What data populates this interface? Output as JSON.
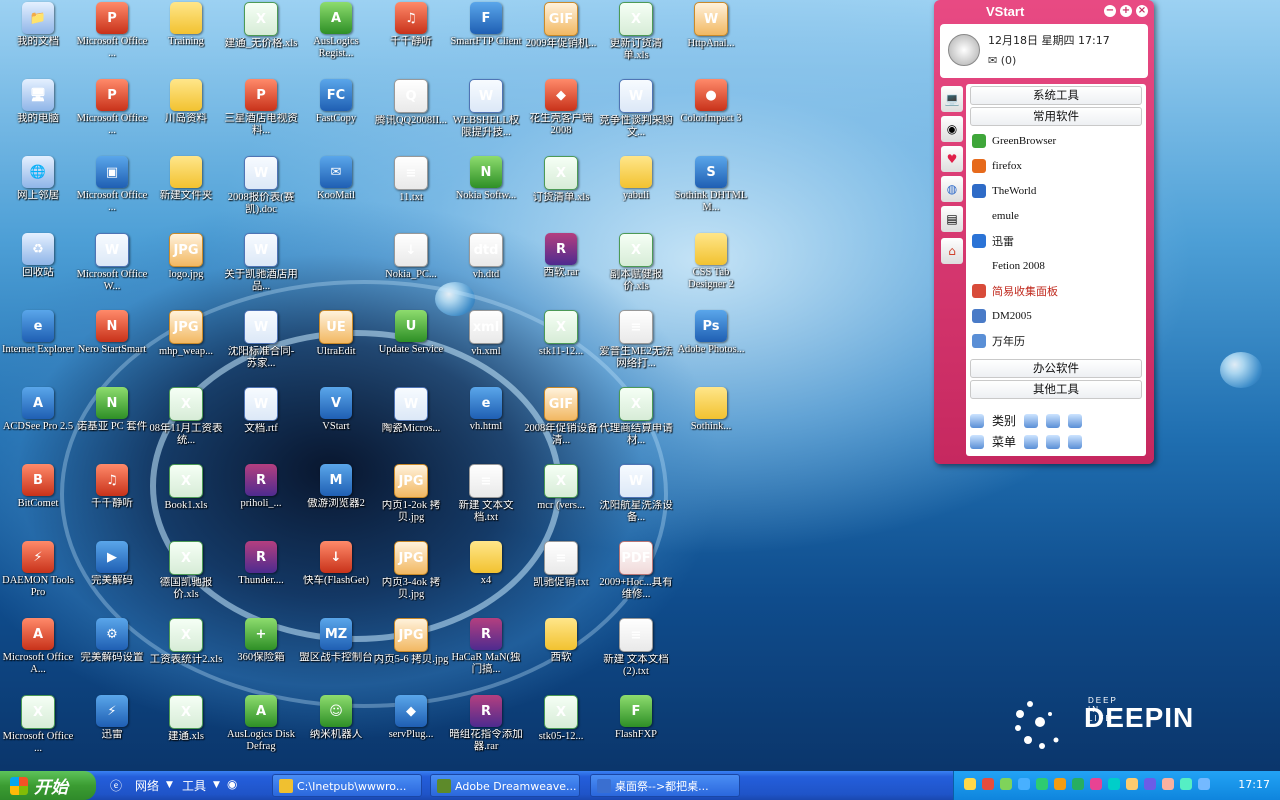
{
  "desktop": {
    "icons": [
      {
        "label": "我的文档",
        "type": "sys",
        "glyph": "📁"
      },
      {
        "label": "Microsoft Office ...",
        "type": "red",
        "glyph": "P"
      },
      {
        "label": "Training",
        "type": "folder",
        "glyph": ""
      },
      {
        "label": "建通_无价格.xls",
        "type": "xls",
        "glyph": "X"
      },
      {
        "label": "AusLogics Regist...",
        "type": "green",
        "glyph": "A"
      },
      {
        "label": "千千静听",
        "type": "red",
        "glyph": "♫"
      },
      {
        "label": "SmartFTP Client",
        "type": "app",
        "glyph": "F"
      },
      {
        "label": "2009年促销机...",
        "type": "jpg",
        "glyph": "GIF"
      },
      {
        "label": "更新订货清单.xls",
        "type": "xls",
        "glyph": "X"
      },
      {
        "label": "HttpAnal...",
        "type": "jpg",
        "glyph": "W"
      },
      {
        "label": "我的电脑",
        "type": "sys",
        "glyph": "🖥"
      },
      {
        "label": "Microsoft Office ...",
        "type": "red",
        "glyph": "P"
      },
      {
        "label": "川岛资料",
        "type": "folder",
        "glyph": ""
      },
      {
        "label": "三星酒店电视资料...",
        "type": "red",
        "glyph": "P"
      },
      {
        "label": "FastCopy",
        "type": "app",
        "glyph": "FC"
      },
      {
        "label": "腾讯QQ2008II...",
        "type": "txt",
        "glyph": "Q"
      },
      {
        "label": "WEBSHELL权限提升技...",
        "type": "doc",
        "glyph": "W"
      },
      {
        "label": "花生壳客户端 2008",
        "type": "red",
        "glyph": "◆"
      },
      {
        "label": "竞争性谈判采购文...",
        "type": "doc",
        "glyph": "W"
      },
      {
        "label": "ColorImpact 3",
        "type": "red",
        "glyph": "●"
      },
      {
        "label": "网上邻居",
        "type": "sys",
        "glyph": "🌐"
      },
      {
        "label": "Microsoft Office ...",
        "type": "app",
        "glyph": "▣"
      },
      {
        "label": "新建文件夹",
        "type": "folder",
        "glyph": ""
      },
      {
        "label": "2008报价表(赛凯).doc",
        "type": "doc",
        "glyph": "W"
      },
      {
        "label": "KooMail",
        "type": "app",
        "glyph": "✉"
      },
      {
        "label": "11.txt",
        "type": "txt",
        "glyph": "≡"
      },
      {
        "label": "Nokia Softw...",
        "type": "green",
        "glyph": "N"
      },
      {
        "label": "订货清单.xls",
        "type": "xls",
        "glyph": "X"
      },
      {
        "label": "yabuli",
        "type": "folder",
        "glyph": ""
      },
      {
        "label": "Sothink DHTML M...",
        "type": "app",
        "glyph": "S"
      },
      {
        "label": "回收站",
        "type": "sys",
        "glyph": "♻"
      },
      {
        "label": "Microsoft Office W...",
        "type": "doc",
        "glyph": "W"
      },
      {
        "label": "logo.jpg",
        "type": "jpg",
        "glyph": "JPG"
      },
      {
        "label": "关于凯驰酒店用品...",
        "type": "doc",
        "glyph": "W"
      },
      {
        "label": "Nokia_PC...",
        "type": "txt",
        "glyph": "↓"
      },
      {
        "label": "vh.dtd",
        "type": "txt",
        "glyph": "dtd"
      },
      {
        "label": "西软.rar",
        "type": "rar",
        "glyph": "R"
      },
      {
        "label": "副本赋健报价.xls",
        "type": "xls",
        "glyph": "X"
      },
      {
        "label": "CSS Tab Designer 2",
        "type": "folder",
        "glyph": ""
      },
      {
        "label": "Internet Explorer",
        "type": "app",
        "glyph": "e"
      },
      {
        "label": "Nero StartSmart",
        "type": "red",
        "glyph": "N"
      },
      {
        "label": "mhp_weap...",
        "type": "jpg",
        "glyph": "JPG"
      },
      {
        "label": "沈阳标准合同-苏家...",
        "type": "doc",
        "glyph": "W"
      },
      {
        "label": "UltraEdit",
        "type": "jpg",
        "glyph": "UE"
      },
      {
        "label": "Update Service",
        "type": "green",
        "glyph": "U"
      },
      {
        "label": "vh.xml",
        "type": "txt",
        "glyph": "xml"
      },
      {
        "label": "stk11-12...",
        "type": "xls",
        "glyph": "X"
      },
      {
        "label": "爱普生ME2无法网络打...",
        "type": "txt",
        "glyph": "≡"
      },
      {
        "label": "Adobe Photos...",
        "type": "app",
        "glyph": "Ps"
      },
      {
        "label": "ACDSee Pro 2.5",
        "type": "app",
        "glyph": "A"
      },
      {
        "label": "诺基亚 PC 套件",
        "type": "green",
        "glyph": "N"
      },
      {
        "label": "08年11月工资表统...",
        "type": "xls",
        "glyph": "X"
      },
      {
        "label": "文档.rtf",
        "type": "doc",
        "glyph": "W"
      },
      {
        "label": "VStart",
        "type": "app",
        "glyph": "V"
      },
      {
        "label": "陶瓷Micros...",
        "type": "doc",
        "glyph": "W"
      },
      {
        "label": "vh.html",
        "type": "app",
        "glyph": "e"
      },
      {
        "label": "2008年促销设备清...",
        "type": "jpg",
        "glyph": "GIF"
      },
      {
        "label": "代理商结算申请材...",
        "type": "xls",
        "glyph": "X"
      },
      {
        "label": "Sothink...",
        "type": "folder",
        "glyph": ""
      },
      {
        "label": "BitComet",
        "type": "red",
        "glyph": "B"
      },
      {
        "label": "千千静听",
        "type": "red",
        "glyph": "♫"
      },
      {
        "label": "Book1.xls",
        "type": "xls",
        "glyph": "X"
      },
      {
        "label": "priholi_...",
        "type": "rar",
        "glyph": "R"
      },
      {
        "label": "傲游浏览器2",
        "type": "app",
        "glyph": "M"
      },
      {
        "label": "内页1-2ok 拷贝.jpg",
        "type": "jpg",
        "glyph": "JPG"
      },
      {
        "label": "新建 文本文档.txt",
        "type": "txt",
        "glyph": "≡"
      },
      {
        "label": "mcr (vers...",
        "type": "xls",
        "glyph": "X"
      },
      {
        "label": "沈阳航星洗涤设备...",
        "type": "doc",
        "glyph": "W"
      },
      {
        "label": "DAEMON Tools Pro",
        "type": "red",
        "glyph": "⚡"
      },
      {
        "label": "完美解码",
        "type": "app",
        "glyph": "▶"
      },
      {
        "label": "德国凯驰报价.xls",
        "type": "xls",
        "glyph": "X"
      },
      {
        "label": "Thunder....",
        "type": "rar",
        "glyph": "R"
      },
      {
        "label": "快车(FlashGet)",
        "type": "red",
        "glyph": "↓"
      },
      {
        "label": "内页3-4ok 拷贝.jpg",
        "type": "jpg",
        "glyph": "JPG"
      },
      {
        "label": "x4",
        "type": "folder",
        "glyph": ""
      },
      {
        "label": "凯驰促销.txt",
        "type": "txt",
        "glyph": "≡"
      },
      {
        "label": "2009+Hoc...具有维修...",
        "type": "pdf",
        "glyph": "PDF"
      },
      {
        "label": "Microsoft Office A...",
        "type": "red",
        "glyph": "A"
      },
      {
        "label": "完美解码设置",
        "type": "app",
        "glyph": "⚙"
      },
      {
        "label": "工资表统计2.xls",
        "type": "xls",
        "glyph": "X"
      },
      {
        "label": "360保险箱",
        "type": "green",
        "glyph": "+"
      },
      {
        "label": "盟区战卡控制台",
        "type": "app",
        "glyph": "MZ"
      },
      {
        "label": "内页5-6 拷贝.jpg",
        "type": "jpg",
        "glyph": "JPG"
      },
      {
        "label": "HaCaR MaN(独门搞...",
        "type": "rar",
        "glyph": "R"
      },
      {
        "label": "西软",
        "type": "folder",
        "glyph": ""
      },
      {
        "label": "新建 文本文档 (2).txt",
        "type": "txt",
        "glyph": "≡"
      },
      {
        "label": "Microsoft Office ...",
        "type": "xls",
        "glyph": "X"
      },
      {
        "label": "迅雷",
        "type": "app",
        "glyph": "⚡"
      },
      {
        "label": "建通.xls",
        "type": "xls",
        "glyph": "X"
      },
      {
        "label": "AusLogics Disk Defrag",
        "type": "green",
        "glyph": "A"
      },
      {
        "label": "纳米机器人",
        "type": "green",
        "glyph": "☺"
      },
      {
        "label": "servPlug...",
        "type": "app",
        "glyph": "◆"
      },
      {
        "label": "暗组花指令添加器.rar",
        "type": "rar",
        "glyph": "R"
      },
      {
        "label": "stk05-12...",
        "type": "xls",
        "glyph": "X"
      },
      {
        "label": "FlashFXP",
        "type": "green",
        "glyph": "F"
      }
    ]
  },
  "vstart": {
    "title": "VStart",
    "controls": [
      "−",
      "+",
      "×"
    ],
    "date": "12月18日  星期四  17:17",
    "mail": "(0)",
    "categories_top": [
      "系统工具",
      "常用软件"
    ],
    "apps": [
      {
        "name": "GreenBrowser",
        "color": "#3fa63a"
      },
      {
        "name": "firefox",
        "color": "#e66a1c"
      },
      {
        "name": "TheWorld",
        "color": "#2e6bc7"
      },
      {
        "name": "emule",
        "color": "#ffffff"
      },
      {
        "name": "迅雷",
        "color": "#2b73d6"
      },
      {
        "name": "Fetion 2008",
        "color": "#ffffff"
      },
      {
        "name": "简易收集面板",
        "color": "#d84b3a"
      },
      {
        "name": "DM2005",
        "color": "#4a7bc7"
      },
      {
        "name": "万年历",
        "color": "#5a8fd6"
      }
    ],
    "categories_bottom": [
      "办公软件",
      "其他工具"
    ],
    "footer": {
      "category_label": "类别",
      "menu_label": "菜单"
    }
  },
  "branding": {
    "tagline": "DEEP IN LIFE",
    "name": "DEEPIN"
  },
  "taskbar": {
    "start_label": "开始",
    "quick": {
      "network": "网络",
      "tools": "工具"
    },
    "tasks": [
      {
        "label": "C:\\Inetpub\\wwwro...",
        "color": "#f0c030"
      },
      {
        "label": "Adobe Dreamweave...",
        "color": "#5d8a2a"
      },
      {
        "label": "桌面祭-->都把桌...",
        "color": "#3a6fd0"
      }
    ],
    "clock": "17:17"
  }
}
